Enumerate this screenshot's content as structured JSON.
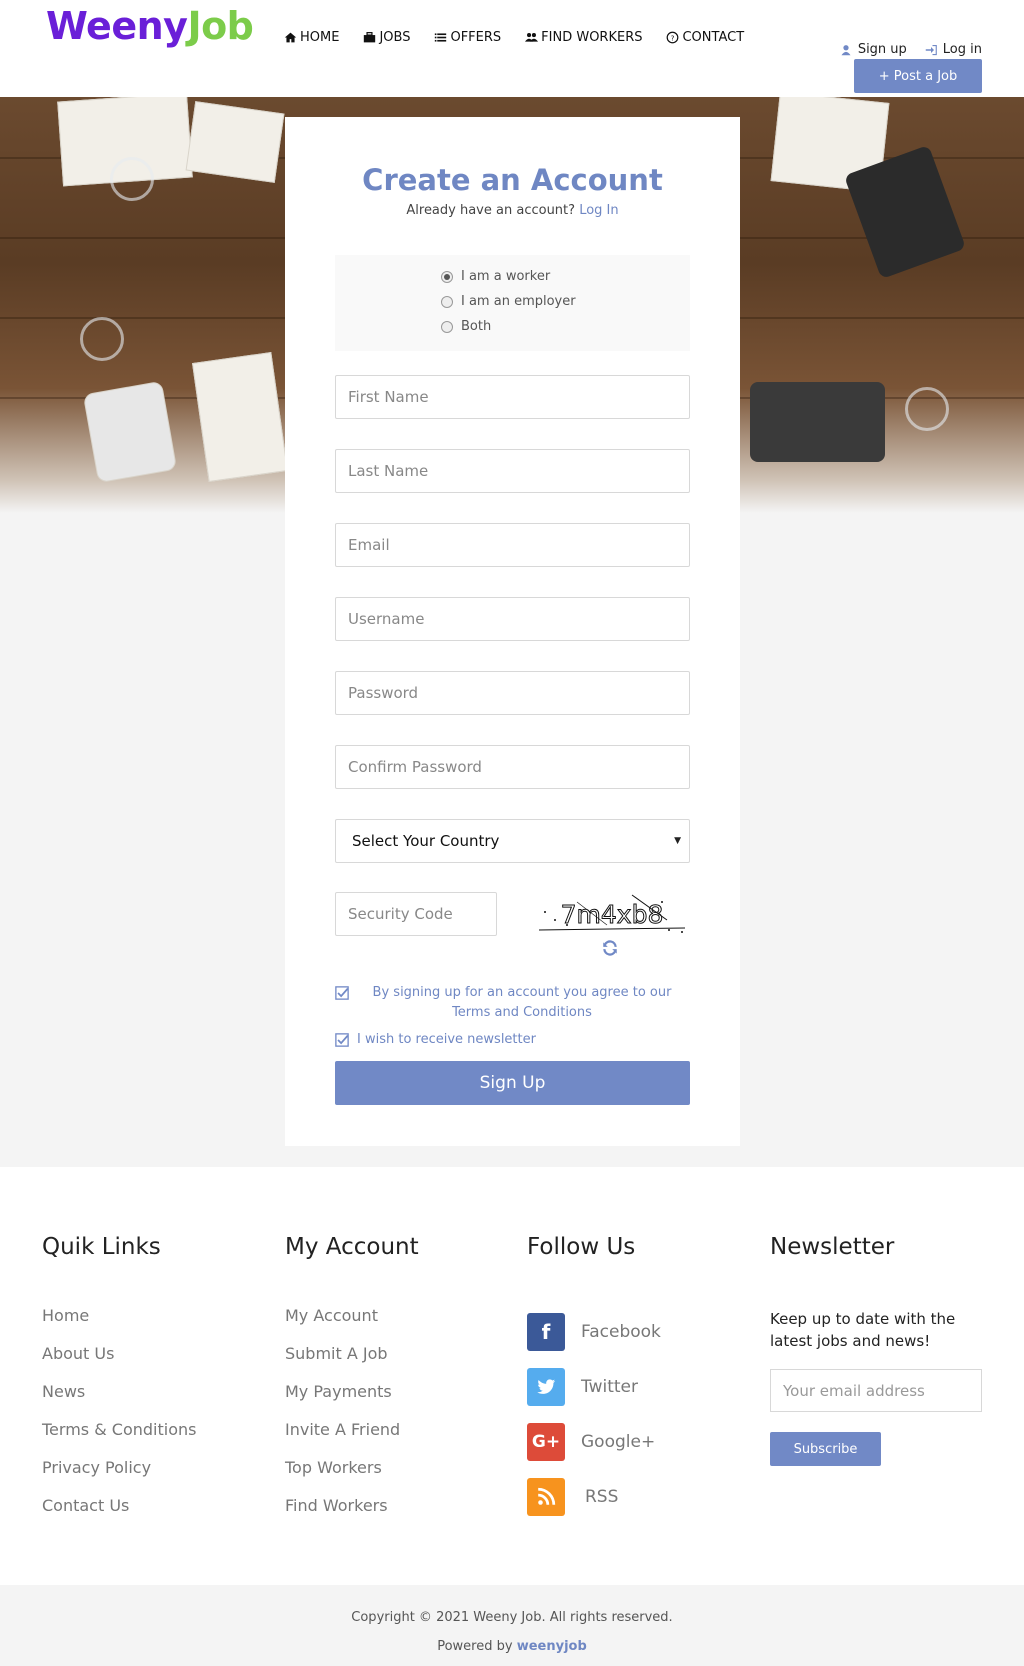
{
  "header": {
    "logo_part1": "Weeny",
    "logo_part2": "Job",
    "nav": [
      {
        "label": "HOME",
        "icon": "home-icon"
      },
      {
        "label": "JOBS",
        "icon": "briefcase-icon"
      },
      {
        "label": "OFFERS",
        "icon": "list-icon"
      },
      {
        "label": "FIND WORKERS",
        "icon": "users-icon"
      },
      {
        "label": "CONTACT",
        "icon": "question-circle-icon"
      }
    ],
    "signup_label": "Sign up",
    "login_label": "Log in",
    "post_job_label": "+ Post a Job"
  },
  "form": {
    "title": "Create an Account",
    "subtitle_text": "Already have an account?",
    "login_link": "Log In",
    "roles": [
      {
        "label": "I am a worker",
        "checked": true
      },
      {
        "label": "I am an employer",
        "checked": false
      },
      {
        "label": "Both",
        "checked": false
      }
    ],
    "first_name_placeholder": "First Name",
    "last_name_placeholder": "Last Name",
    "email_placeholder": "Email",
    "username_placeholder": "Username",
    "password_placeholder": "Password",
    "confirm_password_placeholder": "Confirm Password",
    "country_value": "Select Your Country",
    "security_code_placeholder": "Security Code",
    "captcha_text": "7m4xb8",
    "terms_text": "By signing up for an account you agree to our Terms and Conditions",
    "newsletter_text": "I wish to receive newsletter",
    "signup_button": "Sign Up"
  },
  "footer": {
    "quick_links_title": "Quik Links",
    "quick_links": [
      "Home",
      "About Us",
      "News",
      "Terms & Conditions",
      "Privacy Policy",
      "Contact Us"
    ],
    "account_title": "My Account",
    "account_links": [
      "My Account",
      "Submit A Job",
      "My Payments",
      "Invite A Friend",
      "Top Workers",
      "Find Workers"
    ],
    "follow_title": "Follow Us",
    "social": [
      {
        "label": "Facebook",
        "icon": "facebook-icon",
        "color": "#3b5998"
      },
      {
        "label": "Twitter",
        "icon": "twitter-icon",
        "color": "#55acee"
      },
      {
        "label": "Google+",
        "icon": "google-plus-icon",
        "color": "#dd4b39"
      },
      {
        "label": "RSS",
        "icon": "rss-icon",
        "color": "#f7931e"
      }
    ],
    "newsletter_title": "Newsletter",
    "newsletter_text": "Keep up to date with the latest jobs and news!",
    "newsletter_placeholder": "Your email address",
    "subscribe_label": "Subscribe"
  },
  "bottom": {
    "copyright": "Copyright © 2021 Weeny Job. All rights reserved.",
    "powered_text": "Powered by",
    "powered_brand": "weenyjob"
  },
  "colors": {
    "accent": "#7189c6",
    "logo_purple": "#6a1fd8",
    "logo_green": "#7ccc4a"
  }
}
